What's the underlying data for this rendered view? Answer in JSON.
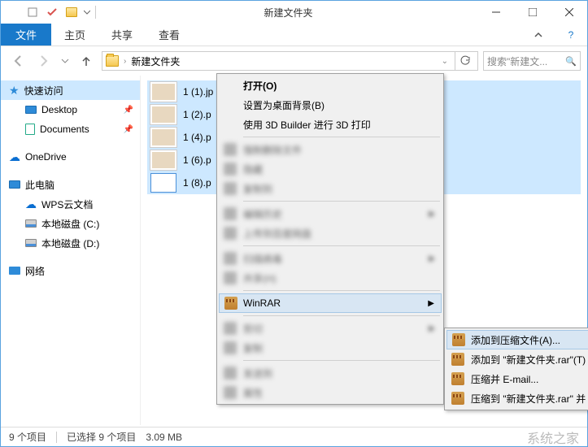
{
  "window": {
    "title": "新建文件夹"
  },
  "ribbon": {
    "file": "文件",
    "tabs": [
      "主页",
      "共享",
      "查看"
    ]
  },
  "address": {
    "path": "新建文件夹"
  },
  "search": {
    "placeholder": "搜索\"新建文..."
  },
  "sidebar": {
    "quick": "快速访问",
    "desktop": "Desktop",
    "documents": "Documents",
    "onedrive": "OneDrive",
    "thispc": "此电脑",
    "wps": "WPS云文档",
    "diskc": "本地磁盘 (C:)",
    "diskd": "本地磁盘 (D:)",
    "network": "网络"
  },
  "files": [
    "1 (1).jp",
    "1 (2).p",
    "1 (4).p",
    "1 (6).p",
    "1 (8).p"
  ],
  "ctx": {
    "open": "打开(O)",
    "wallpaper": "设置为桌面背景(B)",
    "builder3d": "使用 3D Builder 进行 3D 打印",
    "winrar": "WinRAR",
    "blurred": [
      "强制删除文件",
      "隐藏",
      "复制到",
      "编辑历史",
      "上传到百度网盘",
      "扫描病毒",
      "共享(H)",
      "剪切",
      "复制"
    ]
  },
  "submenu": {
    "items": [
      "添加到压缩文件(A)...",
      "添加到 \"新建文件夹.rar\"(T)",
      "压缩并 E-mail...",
      "压缩到 \"新建文件夹.rar\" 并 E-m"
    ]
  },
  "status": {
    "count": "9 个项目",
    "selected": "已选择 9 个项目",
    "size": "3.09 MB"
  },
  "watermark": "系统之家"
}
